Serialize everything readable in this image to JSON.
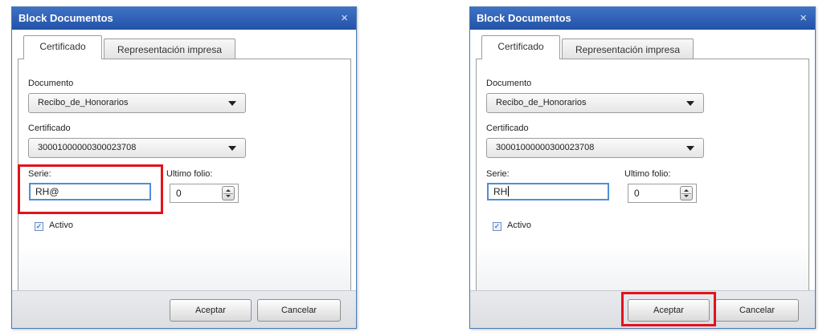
{
  "left_dialog": {
    "title": "Block Documentos",
    "close_glyph": "×",
    "tabs": [
      {
        "label": "Certificado",
        "active": true
      },
      {
        "label": "Representación impresa",
        "active": false
      }
    ],
    "documento": {
      "label": "Documento",
      "value": "Recibo_de_Honorarios"
    },
    "certificado": {
      "label": "Certificado",
      "value": "30001000000300023708"
    },
    "serie": {
      "label": "Serie:",
      "value": "RH@"
    },
    "ultimo_folio": {
      "label": "Ultimo folio:",
      "value": "0"
    },
    "activo": {
      "label": "Activo",
      "checked": true,
      "check_glyph": "✓"
    },
    "buttons": {
      "accept": "Aceptar",
      "cancel": "Cancelar"
    },
    "highlight": "serie"
  },
  "right_dialog": {
    "title": "Block Documentos",
    "close_glyph": "×",
    "tabs": [
      {
        "label": "Certificado",
        "active": true
      },
      {
        "label": "Representación impresa",
        "active": false
      }
    ],
    "documento": {
      "label": "Documento",
      "value": "Recibo_de_Honorarios"
    },
    "certificado": {
      "label": "Certificado",
      "value": "30001000000300023708"
    },
    "serie": {
      "label": "Serie:",
      "value": "RH"
    },
    "ultimo_folio": {
      "label": "Ultimo folio:",
      "value": "0"
    },
    "activo": {
      "label": "Activo",
      "checked": true,
      "check_glyph": "✓"
    },
    "buttons": {
      "accept": "Aceptar",
      "cancel": "Cancelar"
    },
    "highlight": "accept-button"
  },
  "colors": {
    "titlebar": "#2d5fb4",
    "highlight": "#e0141c",
    "input_focus_border": "#4f8fd6"
  }
}
